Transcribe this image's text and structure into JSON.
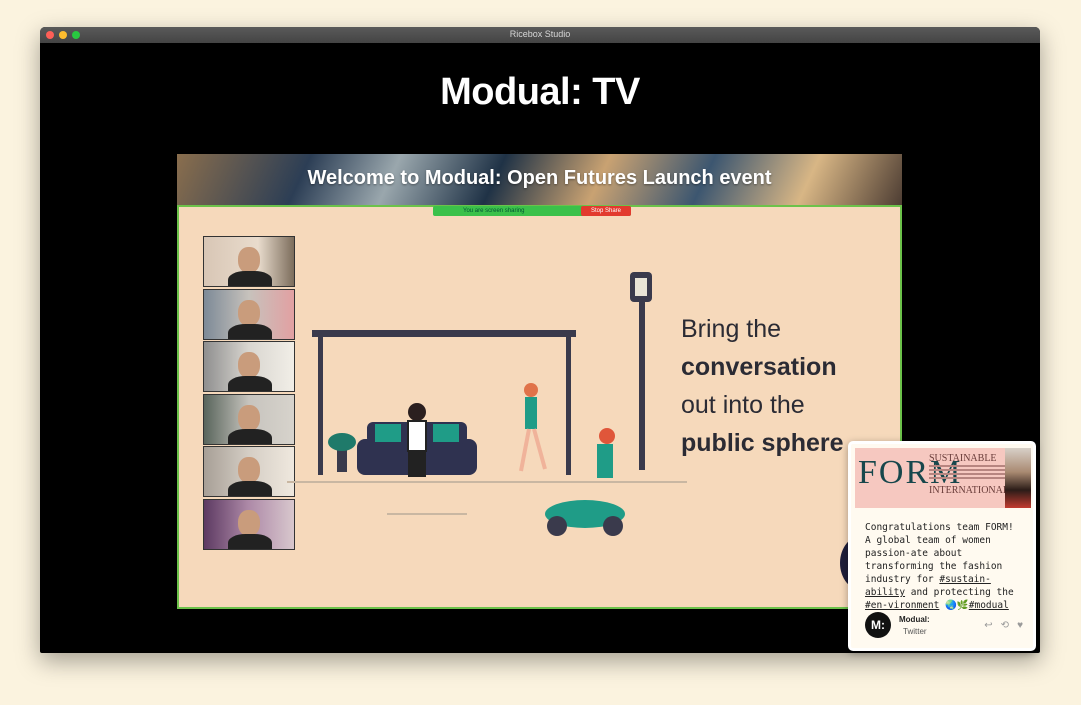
{
  "window": {
    "title": "Ricebox Studio"
  },
  "page": {
    "title": "Modual: TV"
  },
  "video": {
    "banner_title": "Welcome to Modual: Open Futures Launch event",
    "share_bar": {
      "status": "You are screen sharing",
      "stop_label": "Stop Share"
    },
    "slogan": {
      "line1": "Bring the",
      "line2": "conversation",
      "line3": "out into the",
      "line4": "public sphere"
    },
    "participants": [
      {
        "label": "participant-1"
      },
      {
        "label": "participant-2"
      },
      {
        "label": "participant-3"
      },
      {
        "label": "participant-4"
      },
      {
        "label": "participant-5"
      },
      {
        "label": "participant-6"
      }
    ]
  },
  "social_card": {
    "image": {
      "logo": "FORM",
      "line1": "SUSTAINABLE",
      "line2": "INTERNATIONAL"
    },
    "text_plain1": "Congratulations team FORM! A global team of women passion-ate about transforming the fashion industry for ",
    "tag1": "#sustain-ability",
    "text_plain2": " and protecting the ",
    "tag2": "#en-vironment",
    "text_plain3": " 🌏🌿",
    "tag3": "#modual",
    "account": {
      "avatar": "M:",
      "name": "Modual:",
      "source": "Twitter"
    },
    "icons": [
      "reply-icon",
      "retweet-icon",
      "like-icon"
    ]
  }
}
